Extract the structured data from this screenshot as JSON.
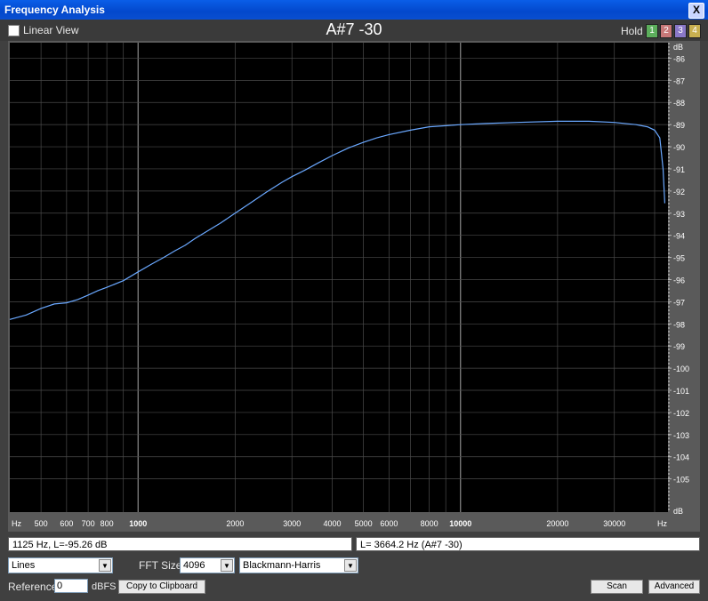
{
  "window": {
    "title": "Frequency Analysis",
    "close_label": "X"
  },
  "toolbar": {
    "linear_view_label": "Linear View",
    "center_title": "A#7 -30",
    "hold_label": "Hold",
    "hold_buttons": [
      {
        "label": "1",
        "color": "#5cae5c"
      },
      {
        "label": "2",
        "color": "#c87878"
      },
      {
        "label": "3",
        "color": "#8a78c8"
      },
      {
        "label": "4",
        "color": "#c8b050"
      }
    ]
  },
  "chart_data": {
    "type": "line",
    "x_scale": "log",
    "x_unit_label": "Hz",
    "y_unit_label": "dB",
    "xlim": [
      400,
      44000
    ],
    "ylim": [
      -106.5,
      -85.3
    ],
    "x_ticks": [
      500,
      600,
      700,
      800,
      1000,
      2000,
      3000,
      4000,
      5000,
      6000,
      8000,
      10000,
      20000,
      30000
    ],
    "x_tick_labels": [
      "500",
      "600",
      "700",
      "800",
      "1000",
      "2000",
      "3000",
      "4000",
      "5000",
      "6000",
      "8000",
      "10000",
      "20000",
      "30000"
    ],
    "major_x": [
      1000,
      10000
    ],
    "y_ticks": [
      -86,
      -87,
      -88,
      -89,
      -90,
      -91,
      -92,
      -93,
      -94,
      -95,
      -96,
      -97,
      -98,
      -99,
      -100,
      -101,
      -102,
      -103,
      -104,
      -105
    ],
    "y_tick_labels": [
      "-86",
      "-87",
      "-88",
      "-89",
      "-90",
      "-91",
      "-92",
      "-93",
      "-94",
      "-95",
      "-96",
      "-97",
      "-98",
      "-99",
      "-100",
      "-101",
      "-102",
      "-103",
      "-104",
      "-105"
    ],
    "grid": true,
    "colors": {
      "background": "#000000",
      "grid": "#4a4a4a",
      "grid_major": "#8a8a8a",
      "line": "#6aa8ff",
      "axis_text": "#ffffff",
      "frame": "#5a5a5a"
    },
    "series": [
      {
        "x": [
          400,
          450,
          500,
          550,
          600,
          650,
          700,
          750,
          800,
          900,
          1000,
          1100,
          1200,
          1300,
          1400,
          1500,
          1600,
          1800,
          2000,
          2200,
          2500,
          2800,
          3000,
          3300,
          3600,
          4000,
          4500,
          5000,
          5500,
          6000,
          7000,
          8000,
          9000,
          10000,
          12000,
          15000,
          20000,
          25000,
          30000,
          35000,
          38000,
          40000,
          41500,
          42500,
          43000
        ],
        "y": [
          -97.8,
          -97.6,
          -97.3,
          -97.1,
          -97.05,
          -96.9,
          -96.7,
          -96.5,
          -96.35,
          -96.05,
          -95.65,
          -95.3,
          -95.0,
          -94.7,
          -94.45,
          -94.15,
          -93.9,
          -93.45,
          -93.0,
          -92.6,
          -92.05,
          -91.6,
          -91.35,
          -91.05,
          -90.75,
          -90.4,
          -90.05,
          -89.8,
          -89.6,
          -89.45,
          -89.25,
          -89.1,
          -89.05,
          -89.0,
          -88.95,
          -88.9,
          -88.85,
          -88.85,
          -88.9,
          -89.0,
          -89.1,
          -89.25,
          -89.6,
          -91.0,
          -92.55
        ]
      }
    ]
  },
  "status": {
    "left": "1125 Hz, L=-95.26 dB",
    "right": "L= 3664.2 Hz (A#7 -30)"
  },
  "controls": {
    "display_mode": "Lines",
    "fft_size_label": "FFT Size",
    "fft_size": "4096",
    "window_function": "Blackmann-Harris",
    "reference_label": "Reference",
    "reference_value": "0",
    "reference_unit": "dBFS",
    "copy_button": "Copy to Clipboard",
    "scan_button": "Scan",
    "advanced_button": "Advanced"
  }
}
